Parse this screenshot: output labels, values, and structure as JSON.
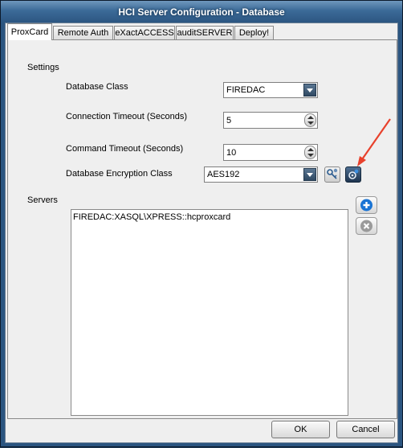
{
  "window": {
    "title": "HCI Server Configuration - Database"
  },
  "tabs": [
    {
      "label": "ProxCard"
    },
    {
      "label": "Remote Auth"
    },
    {
      "label": "eXactACCESS"
    },
    {
      "label": "auditSERVER"
    },
    {
      "label": "Deploy!"
    }
  ],
  "settings": {
    "heading": "Settings",
    "database_class": {
      "label": "Database Class",
      "value": "FIREDAC"
    },
    "connection_timeout": {
      "label": "Connection Timeout (Seconds)",
      "value": "5"
    },
    "command_timeout": {
      "label": "Command Timeout (Seconds)",
      "value": "10"
    },
    "encryption_class": {
      "label": "Database Encryption Class",
      "value": "AES192"
    }
  },
  "servers": {
    "label": "Servers",
    "items": [
      "FIREDAC:XASQL\\XPRESS::hcproxcard"
    ]
  },
  "buttons": {
    "ok": "OK",
    "cancel": "Cancel"
  },
  "colors": {
    "annotation_arrow": "#e8412c",
    "add_button": "#1a74d4",
    "titlebar": "#2f5a86"
  },
  "icons": {
    "encryption_settings": "key-gear-icon",
    "encryption_other": "gear-settings-icon",
    "add": "plus-circle-icon",
    "remove": "x-circle-icon"
  }
}
